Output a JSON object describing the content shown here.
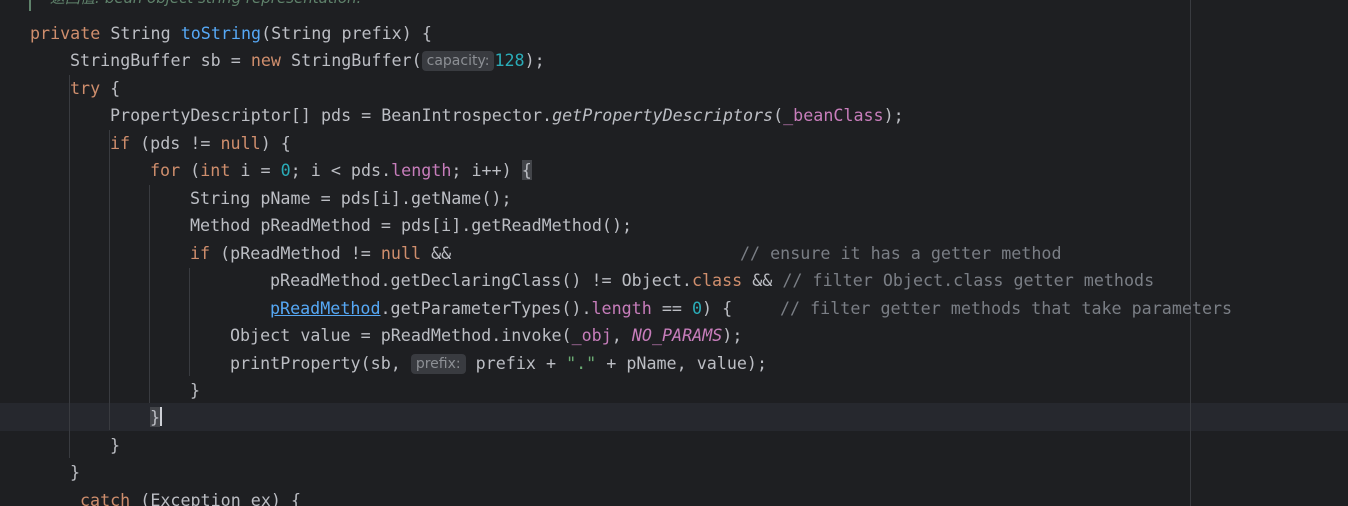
{
  "editor": {
    "language": "java",
    "doc_comment": "返回值: bean object string representation.",
    "lines": {
      "l1": {
        "kw": "private",
        "t1": " String ",
        "fn": "toString",
        "t2": "(String prefix) {"
      },
      "l2": {
        "t1": "StringBuffer sb = ",
        "kw": "new",
        "t2": " StringBuffer(",
        "hint": "capacity:",
        "num": "128",
        "t3": ");"
      },
      "l3": {
        "kw": "try",
        "t1": " {"
      },
      "l4": {
        "t1": "PropertyDescriptor[] pds = BeanIntrospector.",
        "method": "getPropertyDescriptors",
        "t2": "(",
        "field": "_beanClass",
        "t3": ");"
      },
      "l5": {
        "kw": "if",
        "t1": " (pds != ",
        "kw2": "null",
        "t2": ") {"
      },
      "l6": {
        "kw": "for",
        "t1": " (",
        "kw2": "int",
        "t2": " i = ",
        "num": "0",
        "t3": "; i < pds.",
        "field": "length",
        "t4": "; i++) ",
        "brace": "{"
      },
      "l7": {
        "t1": "String pName = pds[i].getName();"
      },
      "l8": {
        "t1": "Method pReadMethod = pds[i].getReadMethod();"
      },
      "l9": {
        "kw": "if",
        "t1": " (pReadMethod != ",
        "kw2": "null",
        "t2": " &&",
        "comment": "// ensure it has a getter method"
      },
      "l10": {
        "t1": "pReadMethod.getDeclaringClass() != Object.",
        "kw": "class",
        "t2": " && ",
        "comment": "// filter Object.class getter methods"
      },
      "l11": {
        "link": "pReadMethod",
        "t1": ".getParameterTypes().",
        "field": "length",
        "t2": " == ",
        "num": "0",
        "t3": ") {",
        "comment": "// filter getter methods that take parameters"
      },
      "l12": {
        "t1": "Object value = pReadMethod.invoke(",
        "field": "_obj",
        "t2": ", ",
        "const": "NO_PARAMS",
        "t3": ");"
      },
      "l13": {
        "t1": "printProperty(sb, ",
        "hint": "prefix:",
        "t2": " prefix + ",
        "str": "\".\"",
        "t3": " + pName, value);"
      },
      "l14": {
        "t1": "}"
      },
      "l15": {
        "brace": "}"
      },
      "l16": {
        "t1": "}"
      },
      "l17": {
        "t1": "}"
      },
      "l18": {
        "kw": "catch",
        "t1": " (Exception ex) {"
      }
    }
  }
}
